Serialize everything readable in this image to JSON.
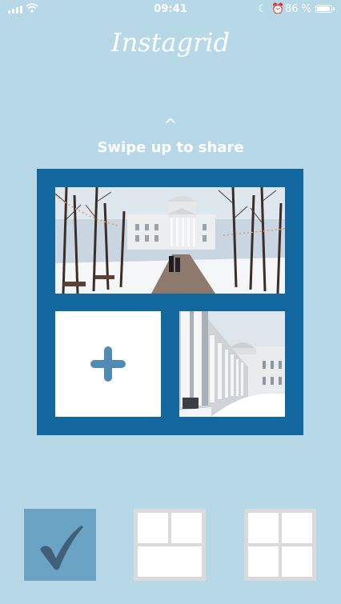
{
  "status_bar": {
    "time": "09:41",
    "battery_percent": "86 %",
    "icons": [
      "signal-icon",
      "wifi-icon",
      "moon-icon",
      "alarm-icon",
      "battery-icon"
    ]
  },
  "app": {
    "title": "Instagrid",
    "swipe_hint": "Swipe up to share",
    "swipe_arrow": "^"
  },
  "grid": {
    "empty_slot_icon": "plus-icon",
    "colors": {
      "frame": "#12679e",
      "background": "#b7d8e6",
      "selected_layout": "#6aa3c4",
      "unselected_layout": "#dadada"
    }
  },
  "layouts": [
    {
      "name": "layout-one-top-two-bottom",
      "selected": true,
      "icon": "checkmark-icon"
    },
    {
      "name": "layout-two-top-one-bottom",
      "selected": false
    },
    {
      "name": "layout-four-squares",
      "selected": false
    }
  ]
}
